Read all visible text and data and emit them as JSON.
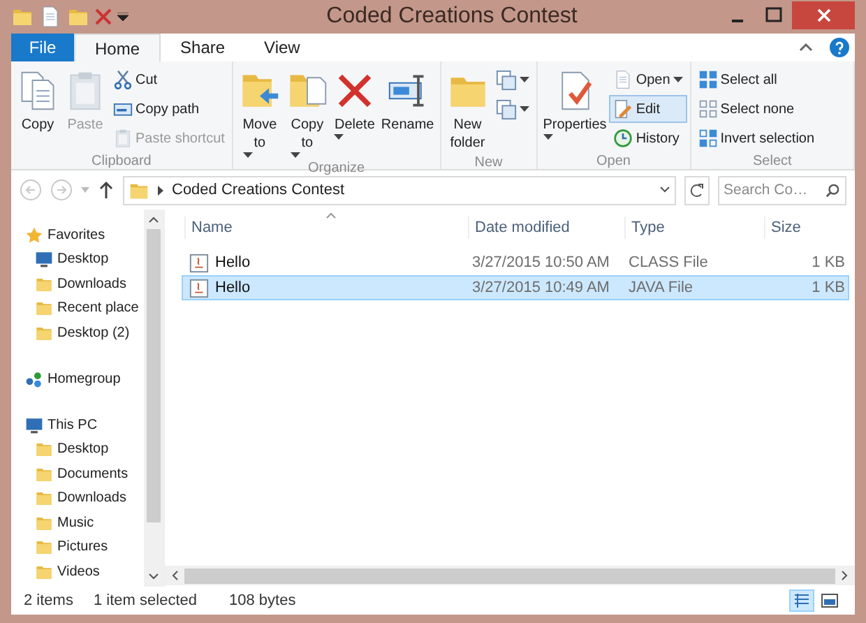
{
  "window": {
    "title": "Coded Creations Contest"
  },
  "tabs": [
    {
      "label": "File",
      "kind": "file",
      "selected": false
    },
    {
      "label": "Home",
      "kind": "tab",
      "selected": true
    },
    {
      "label": "Share",
      "kind": "tab",
      "selected": false
    },
    {
      "label": "View",
      "kind": "tab",
      "selected": false
    }
  ],
  "ribbon": {
    "groups": [
      {
        "label": "Clipboard",
        "buttons": [
          {
            "kind": "large",
            "label": "Copy",
            "disabled": false,
            "dropdown": false,
            "highlighted": false
          },
          {
            "kind": "large",
            "label": "Paste",
            "disabled": true,
            "dropdown": false,
            "highlighted": false
          },
          {
            "kind": "small",
            "label": "Cut",
            "disabled": false,
            "dropdown": false,
            "highlighted": false
          },
          {
            "kind": "small",
            "label": "Copy path",
            "disabled": false,
            "dropdown": false,
            "highlighted": false
          },
          {
            "kind": "small",
            "label": "Paste shortcut",
            "disabled": true,
            "dropdown": false,
            "highlighted": false
          }
        ]
      },
      {
        "label": "Organize",
        "buttons": [
          {
            "kind": "large",
            "label": "Move to",
            "disabled": false,
            "dropdown": true,
            "highlighted": false
          },
          {
            "kind": "large",
            "label": "Copy to",
            "disabled": false,
            "dropdown": true,
            "highlighted": false
          },
          {
            "kind": "large",
            "label": "Delete",
            "disabled": false,
            "dropdown": true,
            "highlighted": false
          },
          {
            "kind": "large",
            "label": "Rename",
            "disabled": false,
            "dropdown": false,
            "highlighted": false
          }
        ]
      },
      {
        "label": "New",
        "buttons": [
          {
            "kind": "large",
            "label": "New folder",
            "disabled": false,
            "dropdown": false,
            "highlighted": false
          },
          {
            "kind": "icon",
            "disabled": false,
            "dropdown": true,
            "highlighted": false
          },
          {
            "kind": "icon",
            "disabled": false,
            "dropdown": true,
            "highlighted": false
          }
        ]
      },
      {
        "label": "Open",
        "buttons": [
          {
            "kind": "large",
            "label": "Properties",
            "disabled": false,
            "dropdown": true,
            "highlighted": false
          },
          {
            "kind": "small",
            "label": "Open",
            "disabled": false,
            "dropdown": true,
            "highlighted": false
          },
          {
            "kind": "small",
            "label": "Edit",
            "disabled": false,
            "dropdown": false,
            "highlighted": true
          },
          {
            "kind": "small",
            "label": "History",
            "disabled": false,
            "dropdown": false,
            "highlighted": false
          }
        ]
      },
      {
        "label": "Select",
        "buttons": [
          {
            "kind": "small",
            "label": "Select all",
            "disabled": false,
            "dropdown": false,
            "highlighted": false
          },
          {
            "kind": "small",
            "label": "Select none",
            "disabled": false,
            "dropdown": false,
            "highlighted": false
          },
          {
            "kind": "small",
            "label": "Invert selection",
            "disabled": false,
            "dropdown": false,
            "highlighted": false
          }
        ]
      }
    ]
  },
  "address_bar": {
    "path": [
      "Coded Creations Contest"
    ],
    "search_placeholder": "Search Co…"
  },
  "navigation": [
    {
      "label": "Favorites",
      "children": [
        {
          "label": "Desktop"
        },
        {
          "label": "Downloads"
        },
        {
          "label": "Recent place"
        },
        {
          "label": "Desktop (2)"
        }
      ]
    },
    {
      "label": "Homegroup"
    },
    {
      "label": "This PC",
      "children": [
        {
          "label": "Desktop"
        },
        {
          "label": "Documents"
        },
        {
          "label": "Downloads"
        },
        {
          "label": "Music"
        },
        {
          "label": "Pictures"
        },
        {
          "label": "Videos"
        }
      ]
    }
  ],
  "file_list": {
    "columns": [
      "Name",
      "Date modified",
      "Type",
      "Size"
    ],
    "rows": [
      {
        "cells": [
          "Hello",
          "3/27/2015 10:50 AM",
          "CLASS File",
          "1 KB"
        ],
        "selected": false
      },
      {
        "cells": [
          "Hello",
          "3/27/2015 10:49 AM",
          "JAVA File",
          "1 KB"
        ],
        "selected": true
      }
    ]
  },
  "status_bar": {
    "texts": [
      "2 items",
      "1 item selected",
      "108 bytes"
    ],
    "views": [
      {
        "kind": "details",
        "selected": true
      },
      {
        "kind": "large_icons",
        "selected": false
      }
    ]
  }
}
